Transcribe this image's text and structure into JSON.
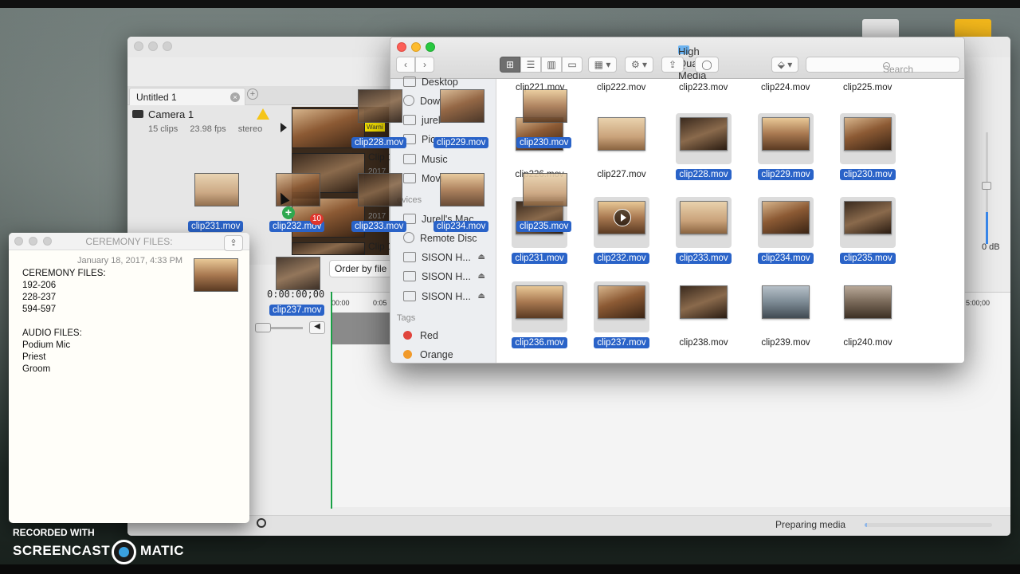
{
  "editor": {
    "tab_title": "Untitled 1",
    "tab_close": "×",
    "tab_add": "+",
    "camera": {
      "name": "Camera 1",
      "clips": "15 clips",
      "fps": "23.98 fps",
      "audio": "stereo"
    },
    "warning_badge": "Warni",
    "strip_labels": [
      "Clip",
      "Clip 1",
      "Clip 1"
    ],
    "strip_sub": [
      "2017",
      "2017"
    ],
    "order_button": "Order by file",
    "timecode": "0:00:00;00",
    "ruler_left": "00:00",
    "ruler_mid": "0:05",
    "ruler_right": "5:00;00",
    "db_label": "0 dB",
    "status": "Preparing media",
    "progress_fraction": 0.02
  },
  "finder": {
    "title": "High Quality Media",
    "nav_back": "‹",
    "nav_forward": "›",
    "view_buttons": [
      "⊞",
      "☰",
      "▥",
      "▭"
    ],
    "group_button": "▦ ▾",
    "action_button": "⚙ ▾",
    "share_button": "⇪",
    "tag_button": "◯",
    "dropbox_button": "⬙ ▾",
    "overflow": "»",
    "search_placeholder": "Search",
    "sidebar": {
      "favorites": [
        "Desktop",
        "Dow",
        "jurel",
        "Pic",
        "Music",
        "Movi"
      ],
      "devices_heading": "evices",
      "devices": [
        "Jurell's Mac...",
        "Remote Disc",
        "SISON H...",
        "SISON H...",
        "SISON H..."
      ],
      "eject": "⏏",
      "tags_heading": "Tags",
      "tags": [
        {
          "name": "Red",
          "color": "#e0443c"
        },
        {
          "name": "Orange",
          "color": "#f19a2b"
        }
      ]
    },
    "top_row_labels": [
      "clip221.mov",
      "clip222.mov",
      "clip223.mov",
      "clip224.mov",
      "clip225.mov"
    ],
    "row2": [
      {
        "name": "clip226.mov",
        "selected": false
      },
      {
        "name": "clip227.mov",
        "selected": false
      },
      {
        "name": "clip228.mov",
        "selected": true
      },
      {
        "name": "clip229.mov",
        "selected": true
      },
      {
        "name": "clip230.mov",
        "selected": true
      }
    ],
    "row3": [
      {
        "name": "clip231.mov",
        "selected": true
      },
      {
        "name": "clip232.mov",
        "selected": true,
        "play_icon": true
      },
      {
        "name": "clip233.mov",
        "selected": true
      },
      {
        "name": "clip234.mov",
        "selected": true
      },
      {
        "name": "clip235.mov",
        "selected": true
      }
    ],
    "row4": [
      {
        "name": "clip236.mov",
        "selected": true
      },
      {
        "name": "clip237.mov",
        "selected": true
      },
      {
        "name": "clip238.mov",
        "selected": false
      },
      {
        "name": "clip239.mov",
        "selected": false
      },
      {
        "name": "clip240.mov",
        "selected": false
      }
    ]
  },
  "dragged_clips": [
    "clip228.mov",
    "clip229.mov",
    "clip230.mov",
    "clip231.mov",
    "clip232.mov",
    "clip233.mov",
    "clip234.mov",
    "clip235.mov",
    "clip236.mov",
    "clip237.mov"
  ],
  "drag_count": "10",
  "drag_plus": "+",
  "notes": {
    "title": "CEREMONY FILES:",
    "date": "January 18, 2017, 4:33 PM",
    "share_icon": "⇪",
    "lines": [
      "CEREMONY FILES:",
      "192-206",
      "228-237",
      "594-597",
      "",
      "AUDIO FILES:",
      "Podium Mic",
      "Priest",
      "Groom"
    ]
  },
  "watermark": {
    "recorded": "RECORDED WITH",
    "brand_left": "SCREENCAST",
    "brand_right": "MATIC"
  }
}
